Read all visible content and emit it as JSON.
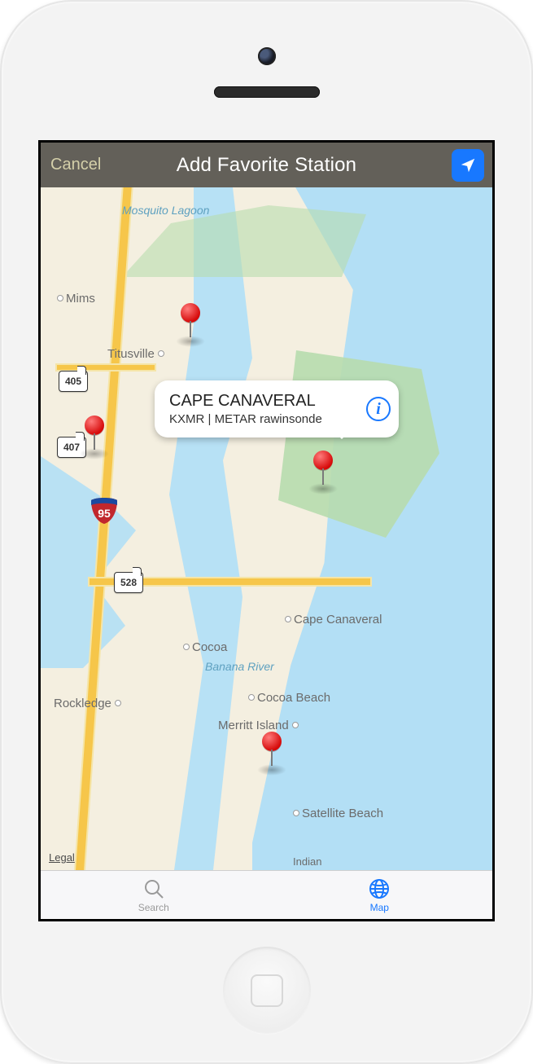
{
  "navbar": {
    "cancel": "Cancel",
    "title": "Add Favorite Station"
  },
  "callout": {
    "title": "CAPE CANAVERAL",
    "subtitle": "KXMR | METAR rawinsonde"
  },
  "places": {
    "mosquito_lagoon": "Mosquito Lagoon",
    "mims": "Mims",
    "titusville": "Titusville",
    "cape_canaveral": "Cape Canaveral",
    "cocoa": "Cocoa",
    "banana_river": "Banana River",
    "rockledge": "Rockledge",
    "cocoa_beach": "Cocoa Beach",
    "merritt_island": "Merritt Island",
    "satellite_beach": "Satellite Beach",
    "indian": "Indian"
  },
  "shields": {
    "s405": "405",
    "s407": "407",
    "s528": "528",
    "i95": "95"
  },
  "legal": "Legal",
  "tabs": {
    "search": "Search",
    "map": "Map"
  }
}
